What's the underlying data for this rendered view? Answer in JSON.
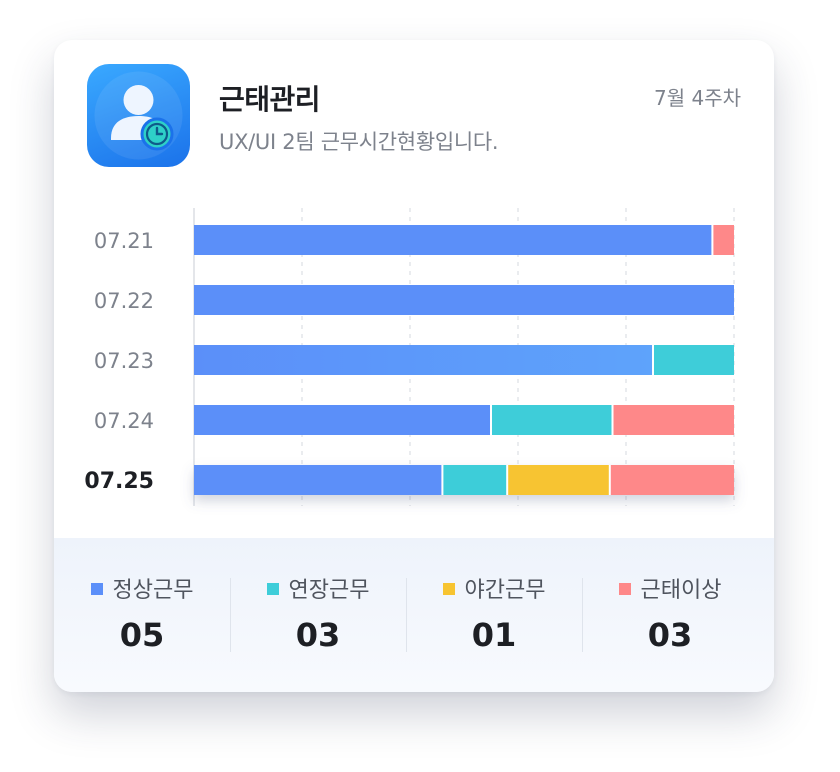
{
  "header": {
    "title": "근태관리",
    "subtitle": "UX/UI 2팀 근무시간현황입니다.",
    "week": "7월 4주차"
  },
  "app_icon": {
    "name": "user-clock-icon"
  },
  "colors": {
    "normal": "#5b8ff9",
    "extended": "#3ecdd9",
    "night": "#f7c431",
    "abnormal": "#fe8889",
    "date_label": "#7d828c",
    "date_label_active": "#1d1f24",
    "grid": "#d4d8df"
  },
  "chart_data": {
    "type": "bar",
    "orientation": "horizontal",
    "stacked": true,
    "categories": [
      "07.21",
      "07.22",
      "07.23",
      "07.24",
      "07.25"
    ],
    "highlighted_category": "07.25",
    "xlim": [
      0,
      100
    ],
    "grid": true,
    "series": [
      {
        "name": "정상근무",
        "color_key": "normal",
        "values": [
          96,
          100,
          85,
          55,
          46
        ]
      },
      {
        "name": "연장근무",
        "color_key": "extended",
        "values": [
          0,
          0,
          15,
          22.5,
          12
        ]
      },
      {
        "name": "야간근무",
        "color_key": "night",
        "values": [
          0,
          0,
          0,
          0,
          19
        ]
      },
      {
        "name": "근태이상",
        "color_key": "abnormal",
        "values": [
          4,
          0,
          0,
          22.5,
          23
        ]
      }
    ]
  },
  "legend": [
    {
      "label": "정상근무",
      "value": "05",
      "color_key": "normal"
    },
    {
      "label": "연장근무",
      "value": "03",
      "color_key": "extended"
    },
    {
      "label": "야간근무",
      "value": "01",
      "color_key": "night"
    },
    {
      "label": "근태이상",
      "value": "03",
      "color_key": "abnormal"
    }
  ]
}
